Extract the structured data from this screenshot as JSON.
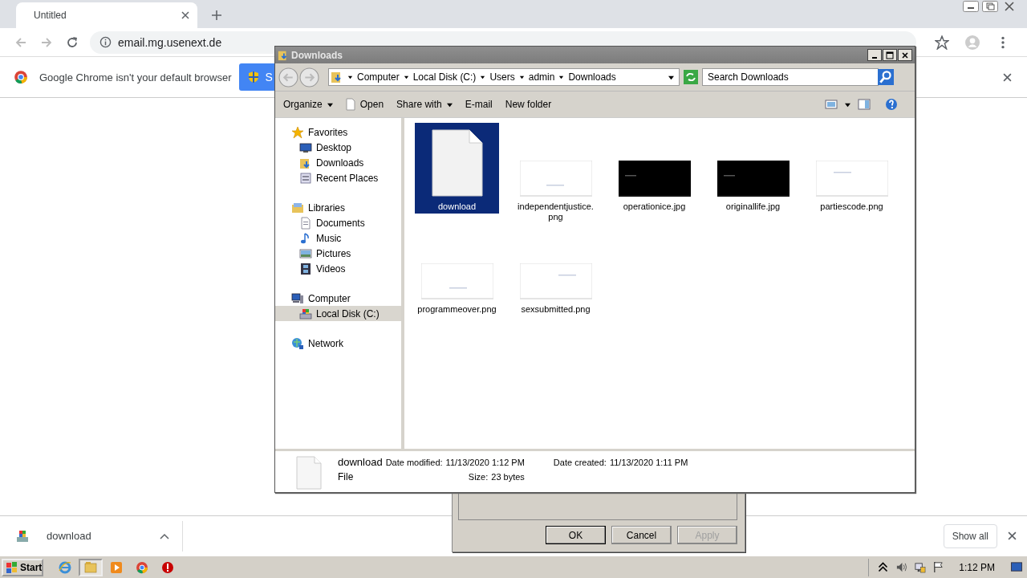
{
  "browser": {
    "tabs": [
      {
        "title": "Untitled",
        "selected": true
      }
    ],
    "address": "email.mg.usenext.de",
    "infobar": {
      "message": "Google Chrome isn't your default browser",
      "button": "S"
    },
    "download_bar": {
      "items": [
        {
          "name": "download"
        }
      ],
      "show_all": "Show all"
    }
  },
  "explorer": {
    "title": "Downloads",
    "breadcrumb": [
      "Computer",
      "Local Disk (C:)",
      "Users",
      "admin",
      "Downloads"
    ],
    "search_placeholder": "Search Downloads",
    "toolbar": [
      {
        "label": "Organize",
        "dropdown": true
      },
      {
        "label": "Open",
        "dropdown": false,
        "kind": "open"
      },
      {
        "label": "Share with",
        "dropdown": true
      },
      {
        "label": "E-mail",
        "dropdown": false
      },
      {
        "label": "New folder",
        "dropdown": false
      }
    ],
    "nav": [
      {
        "label": "Favorites",
        "kind": "star",
        "selected": false,
        "children": [
          {
            "label": "Desktop",
            "kind": "desktop",
            "selected": false
          },
          {
            "label": "Downloads",
            "kind": "downloads",
            "selected": false
          },
          {
            "label": "Recent Places",
            "kind": "recent",
            "selected": false
          }
        ]
      },
      {
        "label": "Libraries",
        "kind": "library",
        "selected": false,
        "children": [
          {
            "label": "Documents",
            "kind": "document",
            "selected": false
          },
          {
            "label": "Music",
            "kind": "music",
            "selected": false
          },
          {
            "label": "Pictures",
            "kind": "pictures",
            "selected": false
          },
          {
            "label": "Videos",
            "kind": "videos",
            "selected": false
          }
        ]
      },
      {
        "label": "Computer",
        "kind": "computer",
        "selected": false,
        "children": [
          {
            "label": "Local Disk (C:)",
            "kind": "disk",
            "selected": true
          }
        ]
      },
      {
        "label": "Network",
        "kind": "network",
        "selected": false
      }
    ],
    "files": [
      {
        "name": "download",
        "kind": "document",
        "selected": true
      },
      {
        "name": "independentjustice.png",
        "kind": "white",
        "selected": false
      },
      {
        "name": "operationice.jpg",
        "kind": "black",
        "selected": false
      },
      {
        "name": "originallife.jpg",
        "kind": "black",
        "selected": false
      },
      {
        "name": "partiescode.png",
        "kind": "white",
        "selected": false
      },
      {
        "name": "programmeover.png",
        "kind": "white",
        "selected": false
      },
      {
        "name": "sexsubmitted.png",
        "kind": "white",
        "selected": false
      }
    ],
    "details": {
      "name": "download",
      "type": "File",
      "fields": [
        {
          "label": "Date modified:",
          "value": "11/13/2020 1:12 PM"
        },
        {
          "label": "Date created:",
          "value": "11/13/2020 1:11 PM"
        },
        {
          "label": "Size:",
          "value": "23 bytes"
        }
      ]
    }
  },
  "dialog": {
    "buttons": [
      {
        "label": "OK",
        "default": true,
        "disabled": false
      },
      {
        "label": "Cancel",
        "default": false,
        "disabled": false
      },
      {
        "label": "Apply",
        "default": false,
        "disabled": true
      }
    ]
  },
  "taskbar": {
    "start": "Start",
    "apps": [
      {
        "kind": "ie",
        "active": false
      },
      {
        "kind": "folder",
        "active": true
      },
      {
        "kind": "media",
        "active": false
      },
      {
        "kind": "chrome",
        "active": false
      },
      {
        "kind": "stop",
        "active": false
      }
    ],
    "clock": "1:12 PM"
  }
}
